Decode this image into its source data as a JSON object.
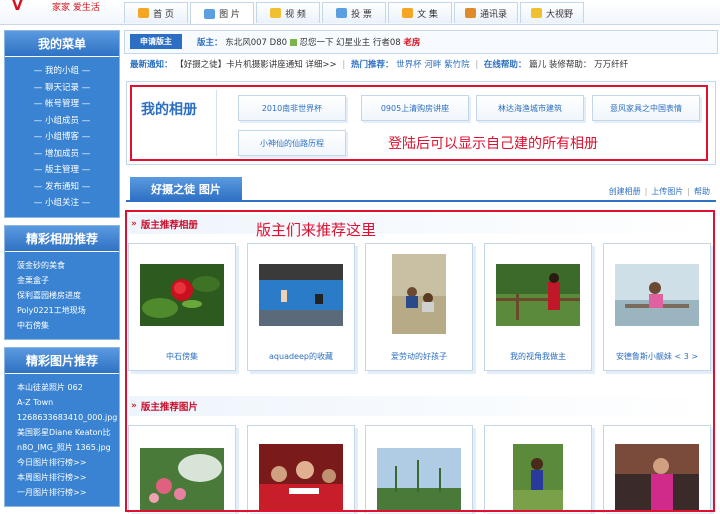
{
  "logo": {
    "text": "家家 爱生活"
  },
  "nav_tabs": [
    {
      "label": "首 页",
      "icon": "home-icon",
      "color": "#f5a623"
    },
    {
      "label": "图 片",
      "icon": "picture-icon",
      "color": "#5aa0e0",
      "active": true
    },
    {
      "label": "视 频",
      "icon": "video-icon",
      "color": "#f0c030"
    },
    {
      "label": "投 票",
      "icon": "vote-icon",
      "color": "#5aa0e0"
    },
    {
      "label": "文 集",
      "icon": "book-icon",
      "color": "#f5a623"
    },
    {
      "label": "通讯录",
      "icon": "contacts-icon",
      "color": "#e08a2a"
    },
    {
      "label": "大视野",
      "icon": "view-icon",
      "color": "#f0c030"
    }
  ],
  "sidebar": {
    "menu_title": "我的菜单",
    "menu_items": [
      "我的小组",
      "聊天记录",
      "帐号管理",
      "小组成员",
      "小组博客",
      "增加成员",
      "版主管理",
      "发布通知",
      "小组关注"
    ],
    "album_title": "精彩相册推荐",
    "album_items": [
      "菠金砂的美食",
      "金栗盒子",
      "保利嘉园楼房进度",
      "Poly0221工地现场",
      "中石傍集"
    ],
    "photo_title": "精彩图片推荐",
    "photo_items": [
      "本山徒弟照片 062",
      "A-Z Town",
      "1268633683410_000.jpg",
      "美国影星Diane Keaton比",
      "n8O_IMG_照片 1365.jpg",
      "今日图片排行榜>>",
      "本周图片排行榜>>",
      "一月图片排行榜>>"
    ]
  },
  "infobar": {
    "apply_label": "申请版主",
    "moderator_label": "版主：",
    "moderators": [
      "东北风007",
      "D80",
      "忍您一下",
      "幻星业主",
      "行者08"
    ],
    "moderator_red": "老房"
  },
  "notice": {
    "latest_label": "最新通知：",
    "latest_text": "【好摄之徒】卡片机摄影讲座通知 详细>>",
    "hot_label": "热门推荐：",
    "hot_items": [
      "世界杯",
      "河畔",
      "紫竹院"
    ],
    "help_label": "在线帮助：",
    "help_items": [
      "篇儿",
      "装修帮助：",
      "万万纤纤"
    ]
  },
  "my_album": {
    "title": "我的相册",
    "albums": [
      "2010南非世界杯",
      "0905上清购房讲座",
      "林达海渔城市建筑",
      "意风家具之中国表情",
      "小神仙的仙路历程"
    ],
    "login_hint": "登陆后可以显示自己建的所有相册"
  },
  "photo_tab": {
    "label": "好摄之徒 图片",
    "links": [
      "创建相册",
      "上传图片",
      "帮助"
    ]
  },
  "recommend": {
    "hint": "版主们来推荐这里",
    "album_section_title": "版主推荐相册",
    "album_cards": [
      {
        "caption": "中石傍集",
        "photo": "red-rose-photo"
      },
      {
        "caption": "aquadeep的收藏",
        "photo": "swimming-pool-photo"
      },
      {
        "caption": "爱劳动的好孩子",
        "photo": "children-playing-photo"
      },
      {
        "caption": "我的视角我做主",
        "photo": "woman-on-fence-photo"
      },
      {
        "caption": "安德鲁斯小靓妹 < 3 >",
        "photo": "girl-on-bench-photo"
      }
    ],
    "photo_section_title": "版主推荐图片",
    "photo_cards": [
      {
        "photo": "pink-flowers-photo"
      },
      {
        "photo": "football-fans-photo"
      },
      {
        "photo": "plants-sky-photo"
      },
      {
        "photo": "girl-in-garden-photo"
      },
      {
        "photo": "woman-in-pink-photo"
      }
    ]
  }
}
